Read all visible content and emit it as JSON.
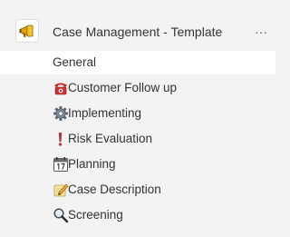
{
  "header": {
    "title": "Case Management - Template",
    "more_label": "···",
    "icon": "megaphone-icon"
  },
  "nav": {
    "items": [
      {
        "label": "General",
        "icon": "",
        "active": true
      },
      {
        "label": "Customer Follow up",
        "icon": "telephone-icon",
        "active": false
      },
      {
        "label": "Implementing",
        "icon": "gear-icon",
        "active": false
      },
      {
        "label": "Risk Evaluation",
        "icon": "exclamation-icon",
        "active": false
      },
      {
        "label": "Planning",
        "icon": "calendar-icon",
        "active": false
      },
      {
        "label": "Case Description",
        "icon": "notepad-pencil-icon",
        "active": false
      },
      {
        "label": "Screening",
        "icon": "magnifier-icon",
        "active": false
      }
    ]
  },
  "colors": {
    "background": "#f3f3f3",
    "active_row": "#ffffff",
    "text": "#333333",
    "telephone": "#c62828",
    "exclamation": "#d32f2f",
    "megaphone": "#e0a000"
  }
}
